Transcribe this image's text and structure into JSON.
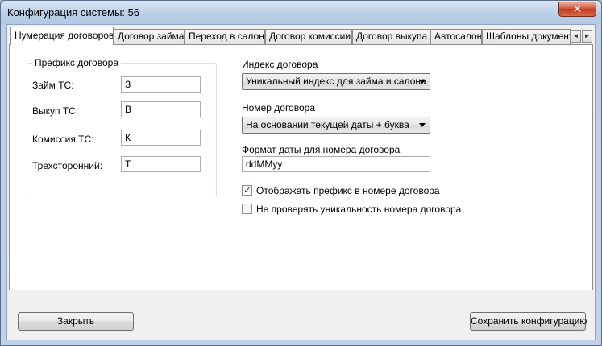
{
  "window": {
    "title": "Конфигурация системы: 56",
    "close_label": "✕",
    "ghost_title_1": "",
    "ghost_title_2": ""
  },
  "tabs": [
    {
      "label": "Нумерация договоров",
      "active": true
    },
    {
      "label": "Договор займа",
      "active": false
    },
    {
      "label": "Переход в салон",
      "active": false
    },
    {
      "label": "Договор комиссии",
      "active": false
    },
    {
      "label": "Договор выкупа",
      "active": false
    },
    {
      "label": "Автосалон",
      "active": false
    },
    {
      "label": "Шаблоны документов",
      "active": false
    }
  ],
  "tab_scroll": {
    "left": "◄",
    "right": "►"
  },
  "prefix_group": {
    "title": "Префикс договора",
    "fields": [
      {
        "label": "Займ ТС:",
        "value": "З"
      },
      {
        "label": "Выкуп ТС:",
        "value": "В"
      },
      {
        "label": "Комиссия ТС:",
        "value": "К"
      },
      {
        "label": "Трехсторонний:",
        "value": "Т"
      }
    ]
  },
  "contract_index": {
    "label": "Индекс договора",
    "value": "Уникальный индекс для займа и салона"
  },
  "contract_number": {
    "label": "Номер договора",
    "value": "На основании текущей даты + буква"
  },
  "date_format": {
    "label": "Формат даты для номера договора",
    "value": "ddMMyy"
  },
  "checkboxes": [
    {
      "label": "Отображать префикс в номере договора",
      "checked": true
    },
    {
      "label": "Не проверять уникальность номера договора",
      "checked": false
    }
  ],
  "footer": {
    "close_button": "Закрыть",
    "save_button": "Сохранить конфигурацию"
  }
}
